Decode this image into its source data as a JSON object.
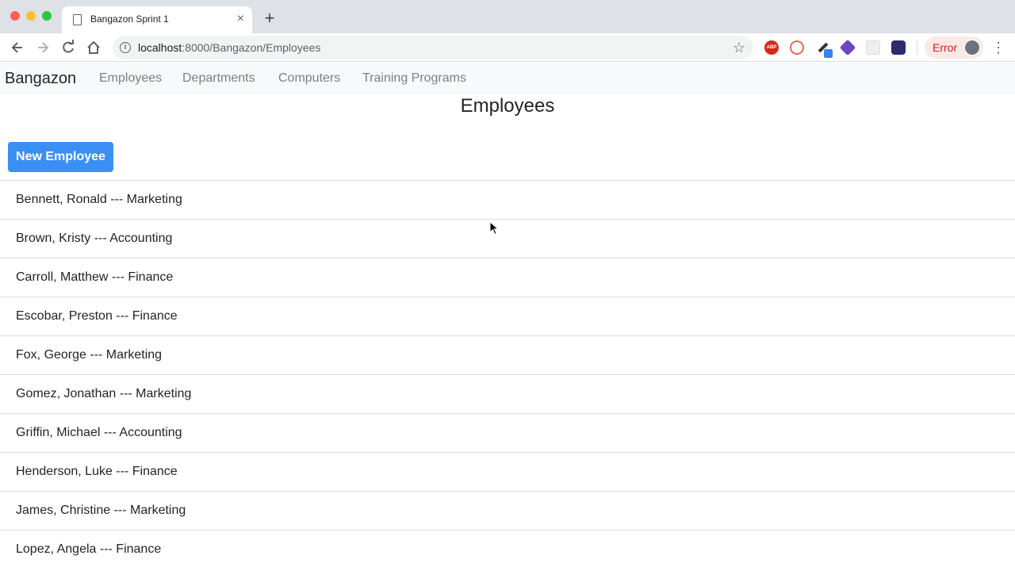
{
  "browser": {
    "tab_title": "Bangazon Sprint 1",
    "url_host": "localhost",
    "url_rest": ":8000/Bangazon/Employees",
    "error_label": "Error",
    "abp_label": "ABP"
  },
  "nav": {
    "brand": "Bangazon",
    "links": [
      "Employees",
      "Departments",
      "Computers",
      "Training Programs"
    ]
  },
  "page": {
    "title": "Employees",
    "new_button": "New Employee"
  },
  "employees": [
    "Bennett, Ronald --- Marketing",
    "Brown, Kristy --- Accounting",
    "Carroll, Matthew --- Finance",
    "Escobar, Preston --- Finance",
    "Fox, George --- Marketing",
    "Gomez, Jonathan --- Marketing",
    "Griffin, Michael --- Accounting",
    "Henderson, Luke --- Finance",
    "James, Christine --- Marketing",
    "Lopez, Angela --- Finance"
  ]
}
